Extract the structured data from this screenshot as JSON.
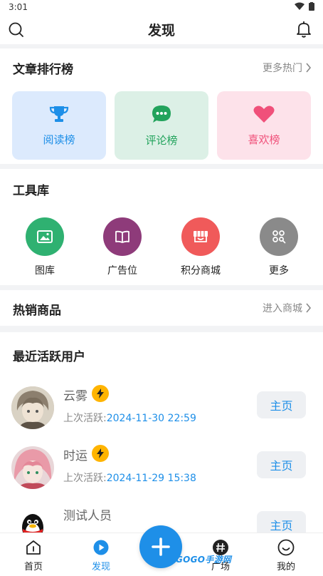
{
  "status_bar": {
    "time": "3:01"
  },
  "header": {
    "title": "发现"
  },
  "ranking": {
    "title": "文章排行榜",
    "more_label": "更多热门",
    "tiles": [
      {
        "label": "阅读榜",
        "icon": "trophy-icon",
        "bg": "#dceafd",
        "color": "#1e8fe8"
      },
      {
        "label": "评论榜",
        "icon": "comment-icon",
        "bg": "#dcf0e6",
        "color": "#22a35c"
      },
      {
        "label": "喜欢榜",
        "icon": "heart-icon",
        "bg": "#fde2ea",
        "color": "#f0507a"
      }
    ]
  },
  "tools": {
    "title": "工具库",
    "items": [
      {
        "label": "图库",
        "icon": "image-icon",
        "color": "#2fb171"
      },
      {
        "label": "广告位",
        "icon": "book-icon",
        "color": "#8e3b7a"
      },
      {
        "label": "积分商城",
        "icon": "shop-icon",
        "color": "#f05a5a"
      },
      {
        "label": "更多",
        "icon": "grid-search-icon",
        "color": "#8a8a8a"
      }
    ]
  },
  "hot_products": {
    "title": "热销商品",
    "more_label": "进入商城"
  },
  "active_users": {
    "title": "最近活跃用户",
    "prefix": "上次活跃:",
    "users": [
      {
        "name": "云雾",
        "last_active": "2024-11-30 22:59",
        "button": "主页"
      },
      {
        "name": "时运",
        "last_active": "2024-11-29 15:38",
        "button": "主页"
      },
      {
        "name": "测试人员",
        "last_active": "",
        "button": "主页"
      }
    ]
  },
  "bottom_nav": {
    "items": [
      {
        "label": "首页",
        "icon": "home-icon",
        "active": false
      },
      {
        "label": "发现",
        "icon": "play-circle-icon",
        "active": true
      },
      {
        "label": "广场",
        "icon": "hash-icon",
        "active": false
      },
      {
        "label": "我的",
        "icon": "smile-icon",
        "active": false
      }
    ]
  },
  "watermark": "GOGO手游网",
  "colors": {
    "accent": "#1e8fe8",
    "bolt": "#ffb400"
  }
}
